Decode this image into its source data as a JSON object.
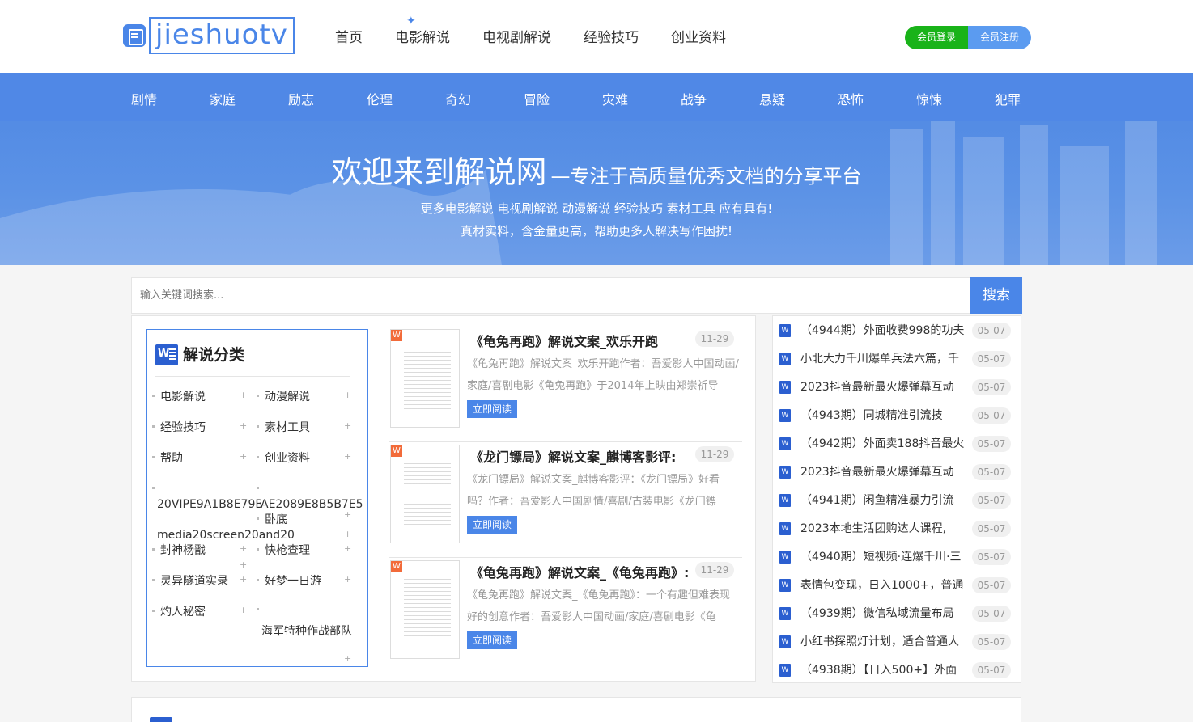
{
  "header": {
    "logo_text": "jieshuotv",
    "nav": [
      "首页",
      "电影解说",
      "电视剧解说",
      "经验技巧",
      "创业资料"
    ],
    "login_label": "会员登录",
    "register_label": "会员注册"
  },
  "category_nav": [
    "剧情",
    "家庭",
    "励志",
    "伦理",
    "奇幻",
    "冒险",
    "灾难",
    "战争",
    "悬疑",
    "恐怖",
    "惊悚",
    "犯罪"
  ],
  "banner": {
    "title_big": "欢迎来到解说网",
    "title_small": "—专注于高质量优秀文档的分享平台",
    "line1": "更多电影解说 电视剧解说 动漫解说 经验技巧 素材工具 应有具有!",
    "line2": "真材实料，含金量更高，帮助更多人解决写作困扰!"
  },
  "search": {
    "placeholder": "输入关键词搜索...",
    "button_label": "搜索"
  },
  "categories": {
    "title": "解说分类",
    "items": [
      "电影解说",
      "动漫解说",
      "经验技巧",
      "素材工具",
      "帮助",
      "创业资料",
      "20VIPE9A1B8E79B8E7A2B9E8B5B7E5",
      "AE2089E8B5B7E5",
      "卧底",
      "media20screen20and20",
      "封神杨戬",
      "快枪查理",
      "灵异隧道实录",
      "好梦一日游",
      "灼人秘密",
      "海军特种作战部队"
    ]
  },
  "documents": [
    {
      "title": "《龟兔再跑》解说文案_欢乐开跑",
      "date": "11-29",
      "desc": "《龟兔再跑》解说文案_欢乐开跑作者：吾爱影人中国动画/家庭/喜剧电影《龟兔再跑》于2014年上映由郑崇祈导",
      "button": "立即阅读"
    },
    {
      "title": "《龙门镖局》解说文案_麒博客影评:",
      "date": "11-29",
      "desc": "《龙门镖局》解说文案_麒博客影评：《龙门镖局》好看吗？作者：吾爱影人中国剧情/喜剧/古装电影《龙门镖",
      "button": "立即阅读"
    },
    {
      "title": "《龟兔再跑》解说文案_《龟兔再跑》:",
      "date": "11-29",
      "desc": "《龟兔再跑》解说文案_《龟兔再跑》：一个有趣但难表现好的创意作者：吾爱影人中国动画/家庭/喜剧电影《龟",
      "button": "立即阅读"
    }
  ],
  "recent": [
    {
      "title": "（4944期）外面收费998的功夫",
      "date": "05-07"
    },
    {
      "title": "小北大力千川爆单兵法六篇，千",
      "date": "05-07"
    },
    {
      "title": "2023抖音最新最火爆弹幕互动",
      "date": "05-07"
    },
    {
      "title": "（4943期）同城精准引流技",
      "date": "05-07"
    },
    {
      "title": "（4942期）外面卖188抖音最火",
      "date": "05-07"
    },
    {
      "title": "2023抖音最新最火爆弹幕互动",
      "date": "05-07"
    },
    {
      "title": "（4941期）闲鱼精准暴力引流",
      "date": "05-07"
    },
    {
      "title": "2023本地生活团购达人课程,",
      "date": "05-07"
    },
    {
      "title": "（4940期）短视频·连爆千川·三",
      "date": "05-07"
    },
    {
      "title": "表情包变现，日入1000+，普通",
      "date": "05-07"
    },
    {
      "title": "（4939期）微信私域流量布局",
      "date": "05-07"
    },
    {
      "title": "小红书探照灯计划，适合普通人",
      "date": "05-07"
    },
    {
      "title": "（4938期）【日入500+】外面",
      "date": "05-07"
    }
  ]
}
